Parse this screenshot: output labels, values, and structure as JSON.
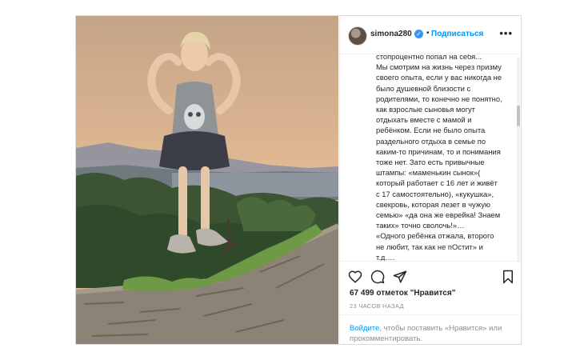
{
  "post": {
    "username": "simona280",
    "verified_icon": "verified-badge-icon",
    "separator": "•",
    "follow_label": "Подписаться",
    "more_icon": "more-options-icon",
    "more_label": "•••",
    "caption": "стопроцентно попал на себя...\nМы смотрим на жизнь через призму своего опыта, если у вас никогда не было душевной близости с родителями, то конечно не понятно, как взрослые сыновья могут отдыхать вместе с мамой и ребёнком. Если не было опыта раздельного отдыха в семье по каким-то причинам, то и понимания тоже нет. Зато есть привычные штампы: «маменькин сынок»( который работает с 16 лет и живёт с 17 самостоятельно), «кукушка», свекровь, которая лезет в чужую семью» «да она же еврейка! Знаем таких» точно сволочь!»…\n«Одного ребёнка отжала, второго не любит, так как не пОстит» и т.д….",
    "likes": "67 499 отметок \"Нравится\"",
    "timestamp": "23 ЧАСОВ НАЗАД",
    "login_link": "Войдите",
    "login_text": ", чтобы поставить «Нравится» или прокомментировать."
  },
  "icons": [
    "heart-icon",
    "comment-icon",
    "share-icon",
    "bookmark-icon"
  ],
  "colors": {
    "accent": "#0095f6",
    "text": "#262626",
    "muted": "#8e8e8e",
    "border": "#dbdbdb"
  }
}
